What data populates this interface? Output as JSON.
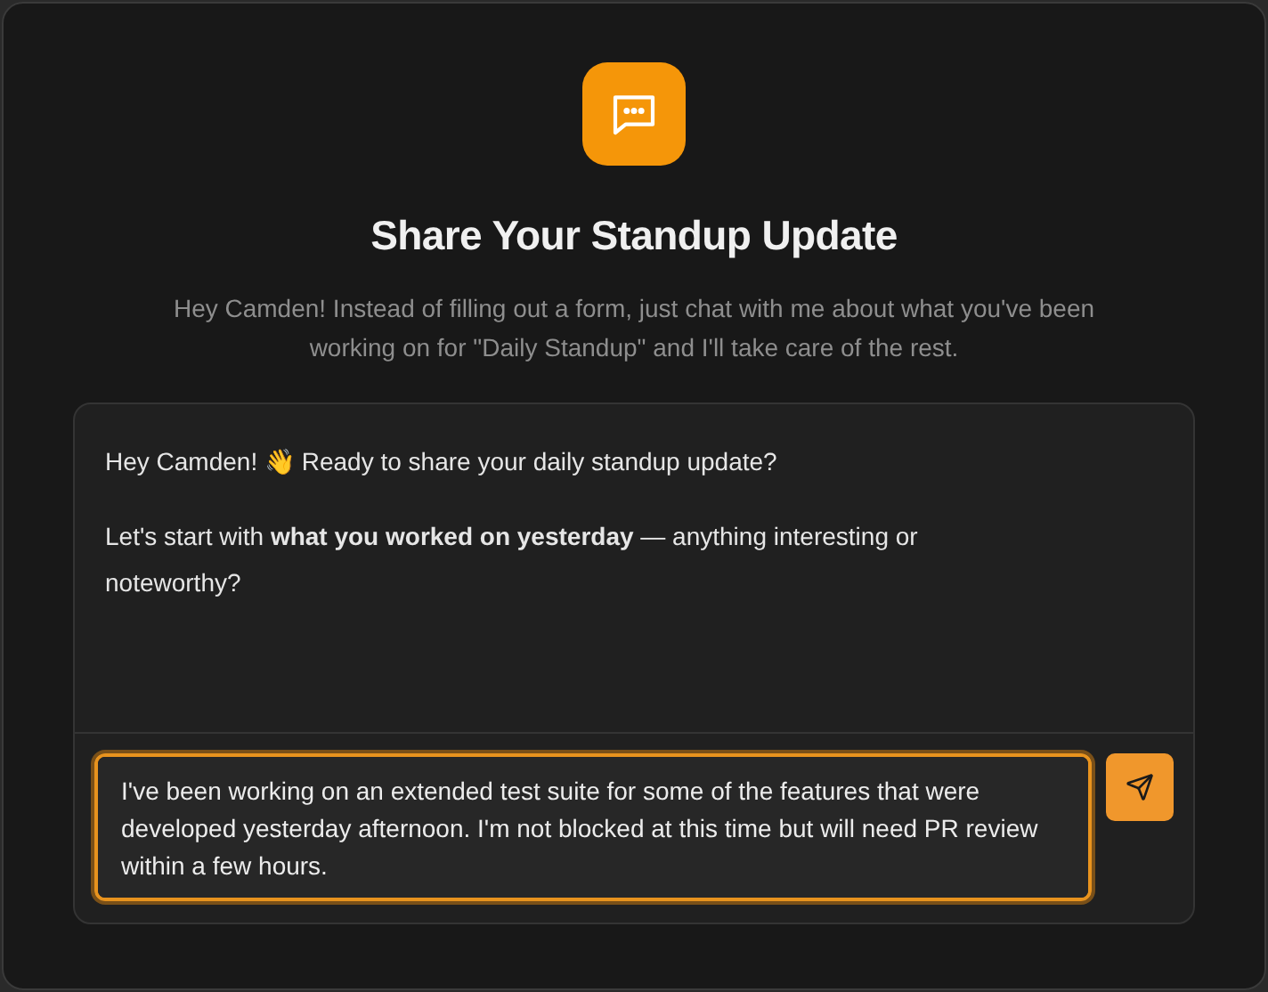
{
  "header": {
    "title": "Share Your Standup Update",
    "subtitle": "Hey Camden! Instead of filling out a form, just chat with me about what you've been working on for \"Daily Standup\" and I'll take care of the rest."
  },
  "messages": [
    {
      "text": "Hey Camden! 👋 Ready to share your daily standup update?"
    },
    {
      "text": "Let's start with **what you worked on yesterday** — anything interesting or noteworthy?"
    }
  ],
  "composer": {
    "value": "I've been working on an extended test suite for some of the features that were developed yesterday afternoon. I'm not blocked at this time but will need PR review within a few hours.",
    "focused": true
  }
}
